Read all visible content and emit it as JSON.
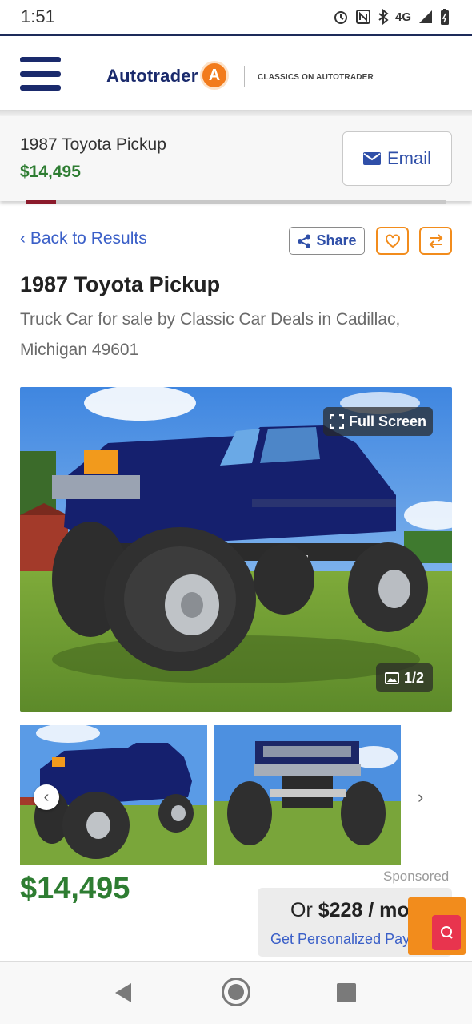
{
  "status_bar": {
    "time": "1:51",
    "network": "4G",
    "icons": [
      "alarm-icon",
      "nfc-icon",
      "bluetooth-icon",
      "lte-icon",
      "signal-icon",
      "battery-icon"
    ]
  },
  "header": {
    "logo_text": "Autotrader",
    "logo_badge": "A",
    "subbrand": "CLASSICS ON AUTOTRADER"
  },
  "sticky": {
    "title": "1987 Toyota Pickup",
    "price": "$14,495",
    "email_label": "Email"
  },
  "nav": {
    "back_label": "‹ Back to Results",
    "share_label": "Share"
  },
  "listing": {
    "title": "1987 Toyota Pickup",
    "subtitle": "Truck Car for sale by Classic Car Deals in Cadillac, Michigan 49601"
  },
  "gallery": {
    "fullscreen_label": "Full Screen",
    "counter": "1/2",
    "prev_glyph": "‹",
    "next_glyph": "›"
  },
  "pricing": {
    "price": "$14,495",
    "sponsored": "Sponsored",
    "finance_prefix": "Or ",
    "finance_amount": "$228 / mo",
    "finance_link": "Get Personalized Payments"
  },
  "colors": {
    "brand_navy": "#1a2a6c",
    "brand_orange": "#f28c1c",
    "price_green": "#2e7d32",
    "link_blue": "#3a5fc8"
  }
}
